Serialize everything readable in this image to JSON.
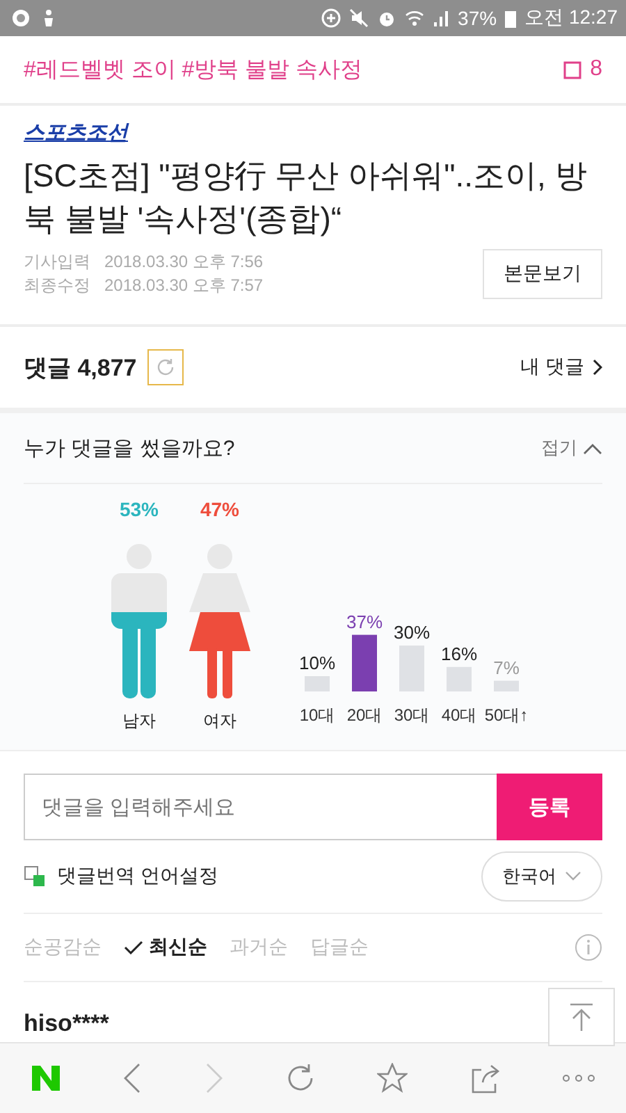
{
  "status_bar": {
    "battery": "37%",
    "time": "오전 12:27"
  },
  "topic_bar": {
    "tags": "#레드벨벳 조이 #방북 불발 속사정",
    "count": "8"
  },
  "article": {
    "source": "스포츠조선",
    "headline": "[SC초점] \"평양行 무산 아쉬워\"..조이, 방북 불발 '속사정'(종합)“",
    "meta": [
      {
        "label": "기사입력",
        "value": "2018.03.30 오후 7:56"
      },
      {
        "label": "최종수정",
        "value": "2018.03.30 오후 7:57"
      }
    ],
    "view_button": "본문보기"
  },
  "comments": {
    "label": "댓글 4,877",
    "my_comments": "내 댓글"
  },
  "stats": {
    "title": "누가 댓글을 썼을까요?",
    "collapse": "접기",
    "gender": [
      {
        "label": "남자",
        "reading": "53%",
        "color": "#2bb5be",
        "kind": "male"
      },
      {
        "label": "여자",
        "reading": "47%",
        "color": "#ee4d3c",
        "kind": "female"
      }
    ],
    "chart_data": {
      "type": "bar",
      "categories": [
        "10대",
        "20대",
        "30대",
        "40대",
        "50대↑"
      ],
      "values": [
        10,
        37,
        30,
        16,
        7
      ],
      "value_labels": [
        "10%",
        "37%",
        "30%",
        "16%",
        "7%"
      ]
    }
  },
  "comment_input": {
    "placeholder": "댓글을 입력해주세요",
    "submit": "등록"
  },
  "translate": {
    "label": "댓글번역 언어설정",
    "language": "한국어"
  },
  "sort_options": [
    {
      "label": "순공감순",
      "selected": false
    },
    {
      "label": "최신순",
      "selected": true
    },
    {
      "label": "과거순",
      "selected": false
    },
    {
      "label": "답글순",
      "selected": false
    }
  ],
  "comment_preview": {
    "user": "hiso****"
  }
}
